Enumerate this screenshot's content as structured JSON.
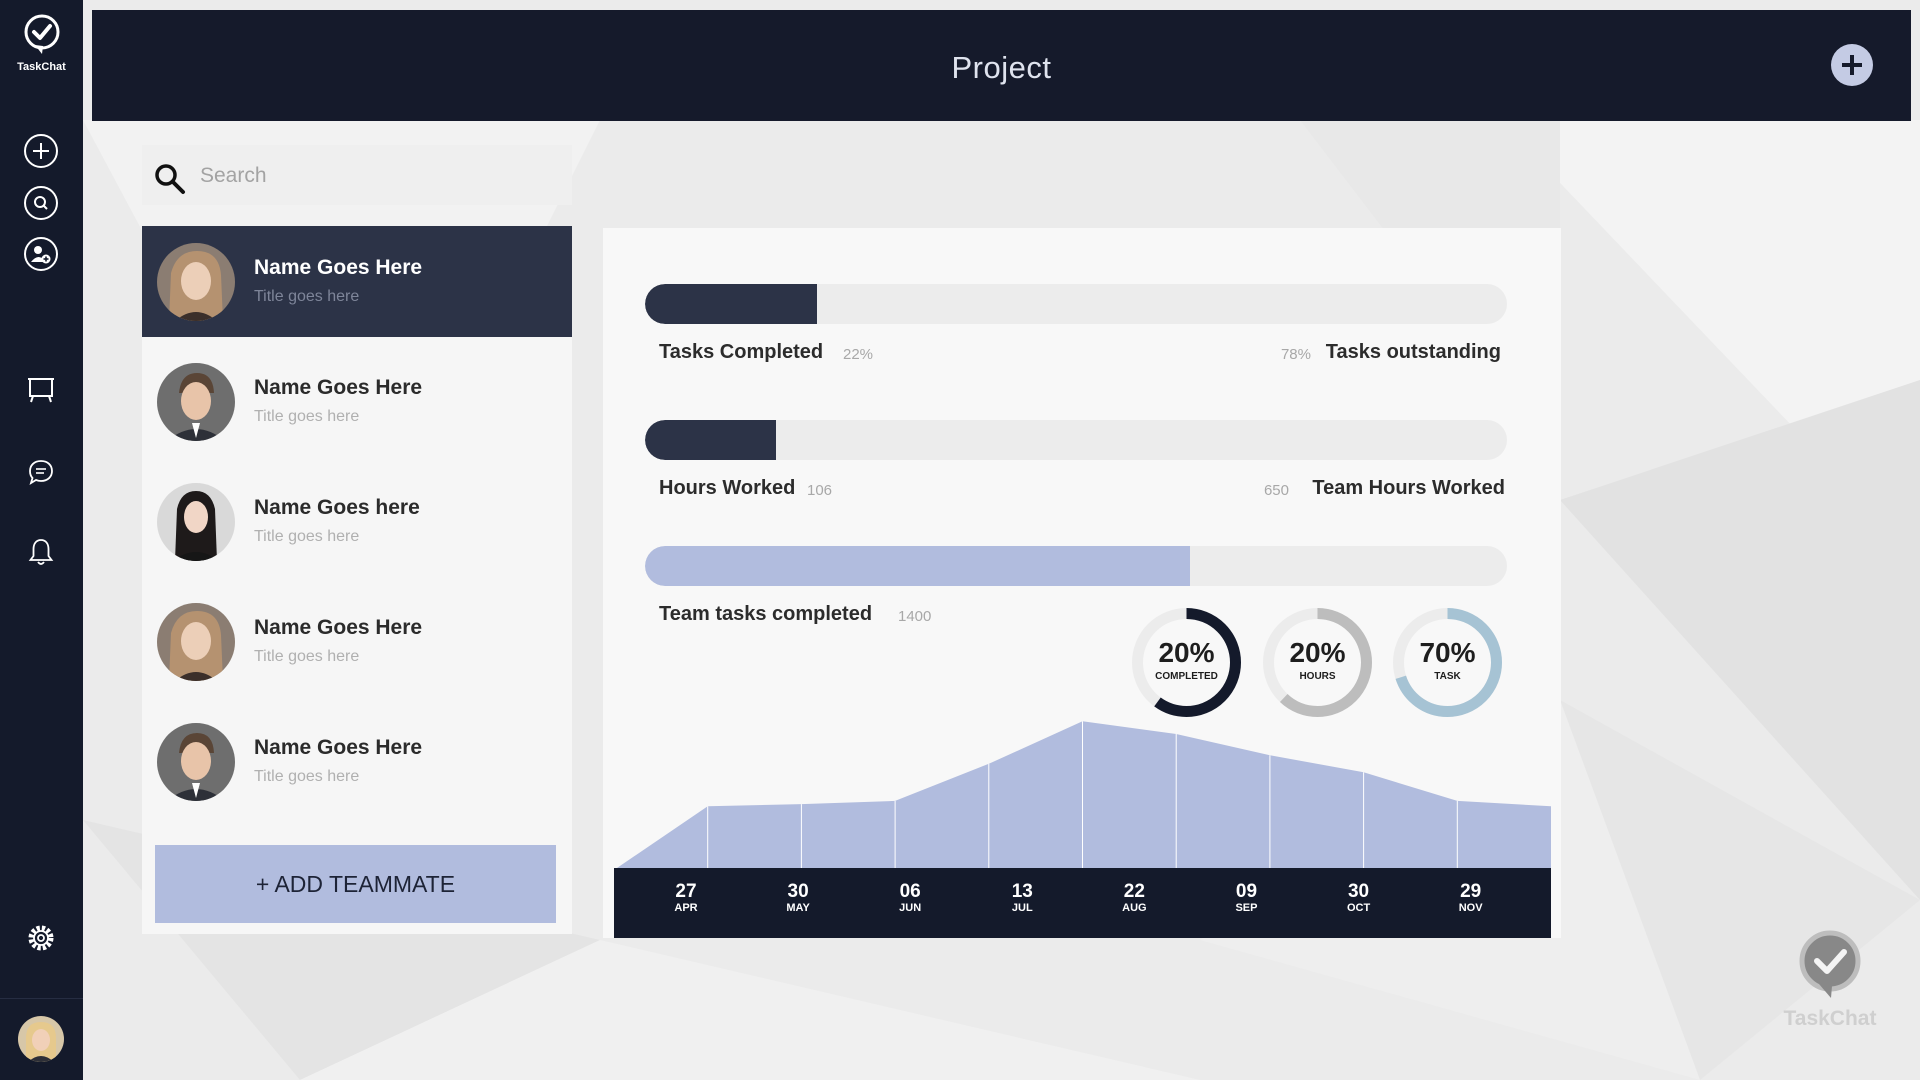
{
  "app": {
    "name": "TaskChat"
  },
  "sidebar": {
    "items": [
      {
        "name": "add-icon"
      },
      {
        "name": "search-icon"
      },
      {
        "name": "add-user-icon"
      },
      {
        "name": "presentation-board-icon"
      },
      {
        "name": "chat-icon"
      },
      {
        "name": "bell-icon"
      },
      {
        "name": "gear-icon"
      }
    ]
  },
  "header": {
    "title": "Project",
    "add_icon": "plus-icon"
  },
  "search": {
    "placeholder": "Search"
  },
  "team": {
    "members": [
      {
        "name": "Name Goes Here",
        "title": "Title goes here",
        "active": true
      },
      {
        "name": "Name Goes Here",
        "title": "Title goes here",
        "active": false
      },
      {
        "name": "Name Goes here",
        "title": "Title goes here",
        "active": false
      },
      {
        "name": "Name Goes Here",
        "title": "Title goes here",
        "active": false
      },
      {
        "name": "Name Goes Here",
        "title": "Title goes here",
        "active": false
      }
    ],
    "add_button": "+ ADD TEAMMATE"
  },
  "stats": {
    "tasks": {
      "label": "Tasks Completed",
      "value": "22%",
      "right_value": "78%",
      "right_label": "Tasks outstanding",
      "fraction": 0.2,
      "color": "#2c3347"
    },
    "hours": {
      "label": "Hours Worked",
      "value": "106",
      "right_value": "650",
      "right_label": "Team Hours Worked",
      "fraction": 0.152,
      "color": "#2c3347"
    },
    "team_tasks": {
      "label": "Team tasks completed",
      "value": "1400",
      "fraction": 0.632,
      "color": "#b1bcde"
    }
  },
  "donuts": [
    {
      "pct": "20%",
      "label": "COMPLETED",
      "fraction": 0.6,
      "color": "#141a2b"
    },
    {
      "pct": "20%",
      "label": "HOURS",
      "fraction": 0.62,
      "color": "#bdbdbd"
    },
    {
      "pct": "70%",
      "label": "TASK",
      "fraction": 0.7,
      "color": "#a6c3d4"
    }
  ],
  "chart_data": {
    "type": "area",
    "categories": [
      "27 APR",
      "30 MAY",
      "06 JUN",
      "13 JUL",
      "22 AUG",
      "09 SEP",
      "30 OCT",
      "29 NOV"
    ],
    "x_ticks": [
      {
        "day": "27",
        "month": "APR"
      },
      {
        "day": "30",
        "month": "MAY"
      },
      {
        "day": "06",
        "month": "JUN"
      },
      {
        "day": "13",
        "month": "JUL"
      },
      {
        "day": "22",
        "month": "AUG"
      },
      {
        "day": "09",
        "month": "SEP"
      },
      {
        "day": "30",
        "month": "OCT"
      },
      {
        "day": "29",
        "month": "NOV"
      }
    ],
    "series": [
      {
        "values": [
          0,
          60,
          62,
          65,
          100,
          140,
          128,
          108,
          92,
          65,
          60
        ]
      }
    ],
    "ylim": [
      0,
      160
    ],
    "grid": false,
    "color": "#b1bcde"
  }
}
